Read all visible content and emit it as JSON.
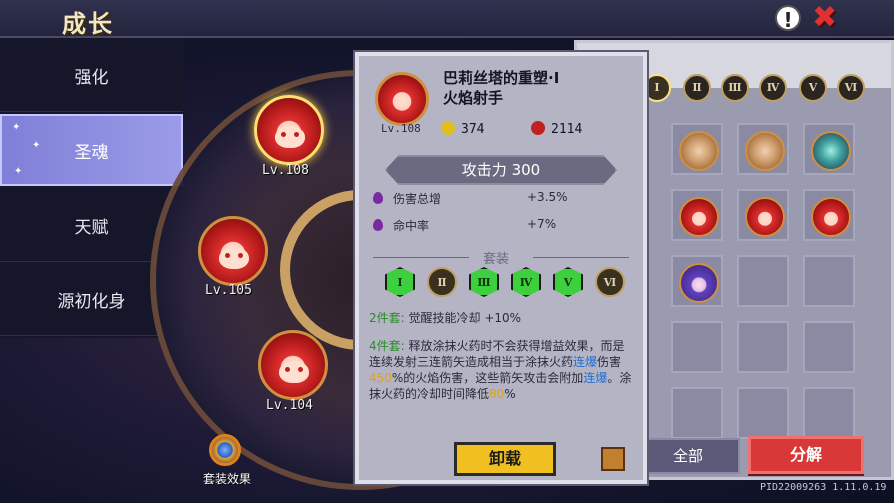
{
  "header": {
    "title": "成长"
  },
  "sidebar": {
    "items": [
      {
        "label": "强化"
      },
      {
        "label": "圣魂"
      },
      {
        "label": "天赋"
      },
      {
        "label": "源初化身"
      }
    ]
  },
  "wheel": {
    "heroes": [
      {
        "level": "Lv.108"
      },
      {
        "level": "Lv.105"
      },
      {
        "level": "Lv.104"
      }
    ],
    "set_effect_label": "套装效果"
  },
  "inventory": {
    "tabs": [
      "Ⅰ",
      "Ⅱ",
      "Ⅲ",
      "Ⅳ",
      "Ⅴ",
      "Ⅵ"
    ],
    "all_button": "全部",
    "decompose_button": "分解"
  },
  "detail": {
    "name_line1": "巴莉丝塔的重塑·I",
    "name_line2": "火焰射手",
    "level": "Lv.108",
    "stat_gold": "374",
    "stat_red": "2114",
    "main_stat": "攻击力 300",
    "substats": [
      {
        "label": "伤害总增",
        "value": "+3.5%"
      },
      {
        "label": "命中率",
        "value": "+7%"
      }
    ],
    "set_title": "套装",
    "set_gems": [
      "Ⅰ",
      "Ⅱ",
      "Ⅲ",
      "Ⅳ",
      "Ⅴ",
      "Ⅵ"
    ],
    "set2_tag": "2件套:",
    "set2_text": "觉醒技能冷却 +10%",
    "set4_tag": "4件套:",
    "set4_a": "释放涂抹火药时不会获得增益效果，而是连续发射三连箭矢造成相当于涂抹火药",
    "set4_hl1": "连爆",
    "set4_b": "伤害",
    "set4_hl2": "450",
    "set4_c": "%的火焰伤害，这些箭矢攻击会附加",
    "set4_hl3": "连爆",
    "set4_d": "。涂抹火药的冷却时间降低",
    "set4_hl4": "80",
    "set4_e": "%",
    "unequip_button": "卸载"
  },
  "footer": {
    "pid": "PID22009263 1.11.0.19"
  },
  "colors": {
    "accent_green": "#3ecf3e",
    "decompose_red": "#d83838",
    "unequip_yellow": "#f0c020"
  }
}
